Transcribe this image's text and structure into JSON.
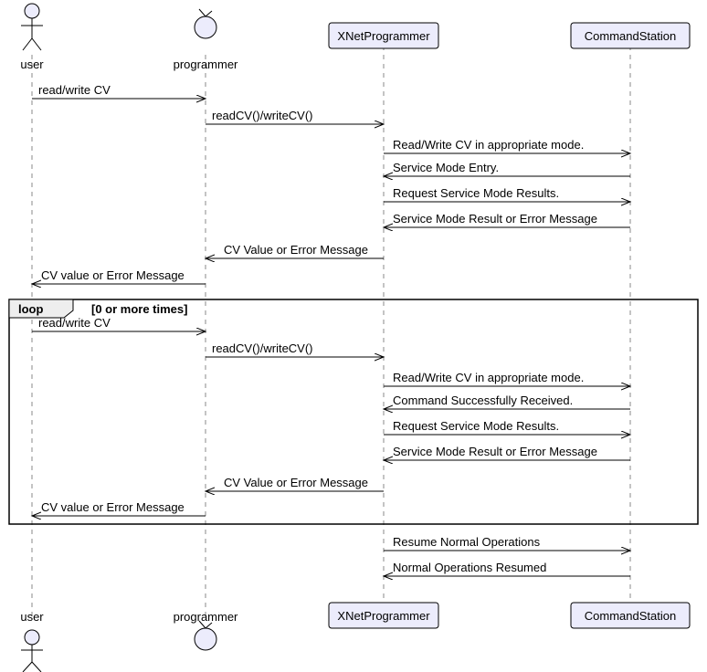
{
  "participants": {
    "user": "user",
    "programmer": "programmer",
    "xnet": "XNetProgrammer",
    "cs": "CommandStation"
  },
  "messages": {
    "m1": "read/write CV",
    "m2": "readCV()/writeCV()",
    "m3": "Read/Write CV in appropriate mode.",
    "m4": "Service Mode Entry.",
    "m5": "Request Service Mode Results.",
    "m6": "Service Mode Result or Error Message",
    "m7": "CV Value or Error Message",
    "m8": "CV value or Error Message",
    "loop_m1": "read/write CV",
    "loop_m2": "readCV()/writeCV()",
    "loop_m3": "Read/Write CV in appropriate mode.",
    "loop_m4": "Command Successfully Received.",
    "loop_m5": "Request Service Mode Results.",
    "loop_m6": "Service Mode Result or Error Message",
    "loop_m7": "CV Value or Error Message",
    "loop_m8": "CV value or Error Message",
    "f1": "Resume Normal Operations",
    "f2": "Normal Operations Resumed"
  },
  "loop": {
    "label": "loop",
    "condition": "[0 or more times]"
  },
  "chart_data": {
    "type": "sequence-diagram",
    "participants": [
      "user",
      "programmer",
      "XNetProgrammer",
      "CommandStation"
    ],
    "interactions": [
      {
        "from": "user",
        "to": "programmer",
        "label": "read/write CV"
      },
      {
        "from": "programmer",
        "to": "XNetProgrammer",
        "label": "readCV()/writeCV()"
      },
      {
        "from": "XNetProgrammer",
        "to": "CommandStation",
        "label": "Read/Write CV in appropriate mode."
      },
      {
        "from": "CommandStation",
        "to": "XNetProgrammer",
        "label": "Service Mode Entry."
      },
      {
        "from": "XNetProgrammer",
        "to": "CommandStation",
        "label": "Request Service Mode Results."
      },
      {
        "from": "CommandStation",
        "to": "XNetProgrammer",
        "label": "Service Mode Result or Error Message"
      },
      {
        "from": "XNetProgrammer",
        "to": "programmer",
        "label": "CV Value or Error Message"
      },
      {
        "from": "programmer",
        "to": "user",
        "label": "CV value or Error Message"
      },
      {
        "fragment": "loop",
        "condition": "0 or more times",
        "body": [
          {
            "from": "user",
            "to": "programmer",
            "label": "read/write CV"
          },
          {
            "from": "programmer",
            "to": "XNetProgrammer",
            "label": "readCV()/writeCV()"
          },
          {
            "from": "XNetProgrammer",
            "to": "CommandStation",
            "label": "Read/Write CV in appropriate mode."
          },
          {
            "from": "CommandStation",
            "to": "XNetProgrammer",
            "label": "Command Successfully Received."
          },
          {
            "from": "XNetProgrammer",
            "to": "CommandStation",
            "label": "Request Service Mode Results."
          },
          {
            "from": "CommandStation",
            "to": "XNetProgrammer",
            "label": "Service Mode Result or Error Message"
          },
          {
            "from": "XNetProgrammer",
            "to": "programmer",
            "label": "CV Value or Error Message"
          },
          {
            "from": "programmer",
            "to": "user",
            "label": "CV value or Error Message"
          }
        ]
      },
      {
        "from": "XNetProgrammer",
        "to": "CommandStation",
        "label": "Resume Normal Operations"
      },
      {
        "from": "CommandStation",
        "to": "XNetProgrammer",
        "label": "Normal Operations Resumed"
      }
    ]
  }
}
